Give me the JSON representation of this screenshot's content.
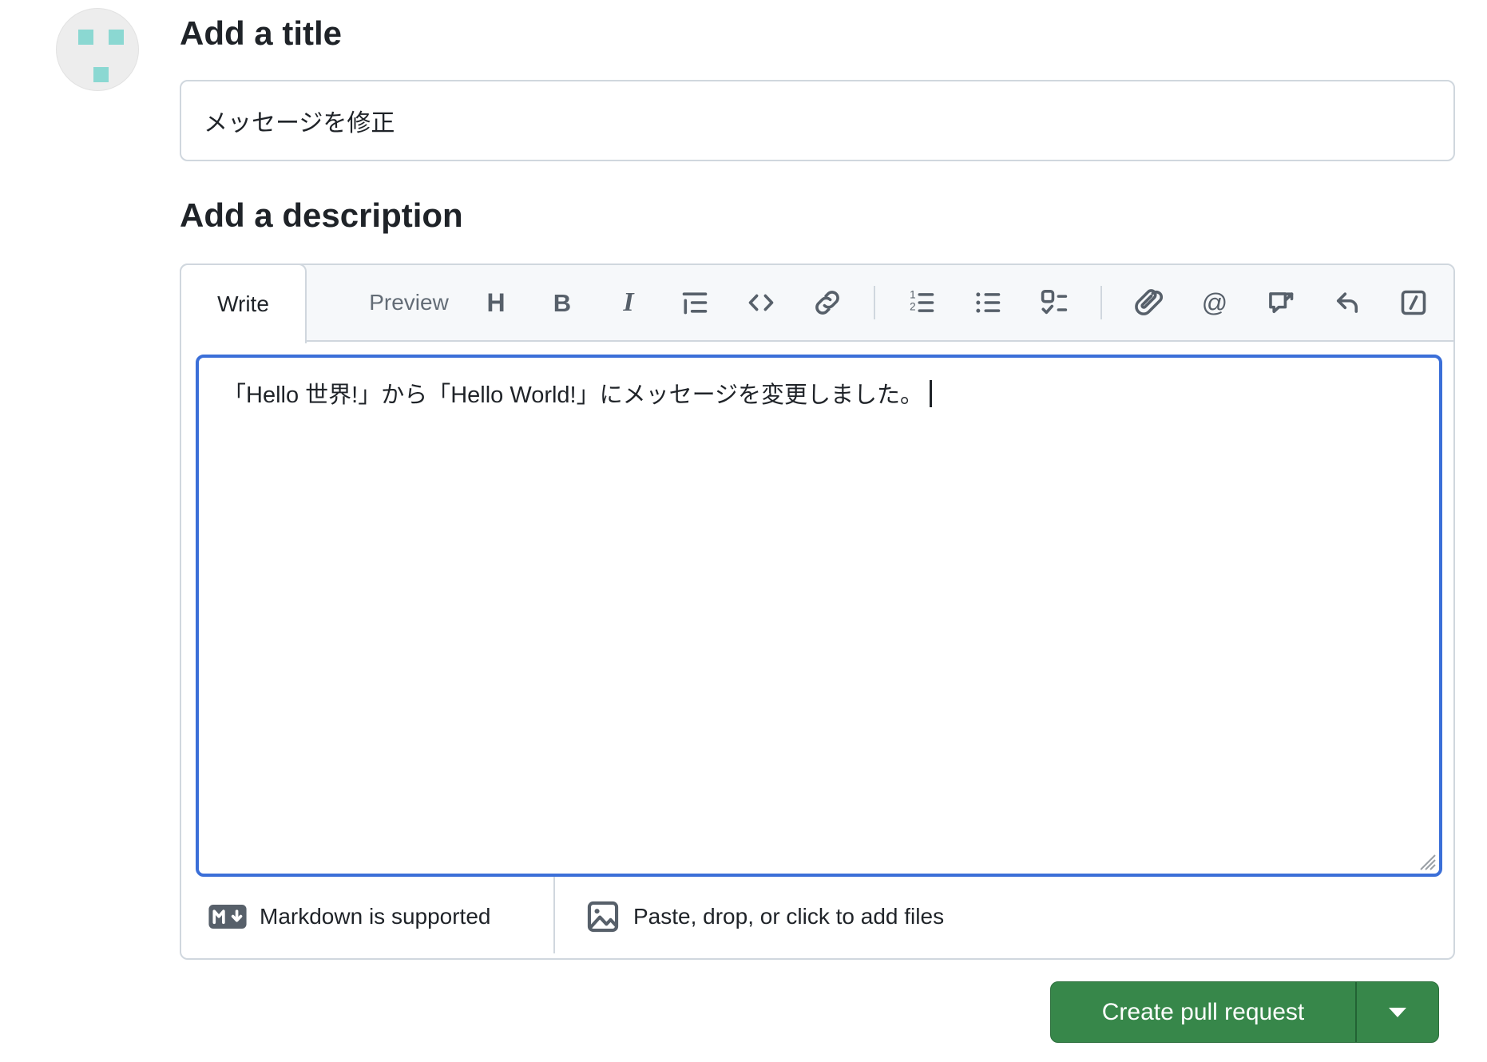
{
  "colors": {
    "accent_green": "#37874a",
    "focus_blue": "#3b6fd8",
    "avatar_teal": "#8bd8d2",
    "border_gray": "#d0d7de",
    "toolbar_bg": "#f6f8fa",
    "icon_gray": "#57606a",
    "text": "#1f2328",
    "muted_text": "#636c76"
  },
  "title_section": {
    "heading": "Add a title",
    "value": "メッセージを修正"
  },
  "description_section": {
    "heading": "Add a description",
    "tabs": {
      "write": "Write",
      "preview": "Preview"
    },
    "toolbar_items": [
      "heading",
      "bold",
      "italic",
      "quote",
      "code",
      "link",
      "divider",
      "list-ordered",
      "list-unordered",
      "tasklist",
      "divider",
      "paperclip",
      "mention",
      "cross-reference",
      "reply",
      "slash-command"
    ],
    "editor": {
      "value": "「Hello 世界!」から「Hello World!」にメッセージを変更しました。"
    },
    "footer": {
      "markdown_hint": "Markdown is supported",
      "upload_hint": "Paste, drop, or click to add files"
    }
  },
  "actions": {
    "create_pull_request": "Create pull request"
  }
}
